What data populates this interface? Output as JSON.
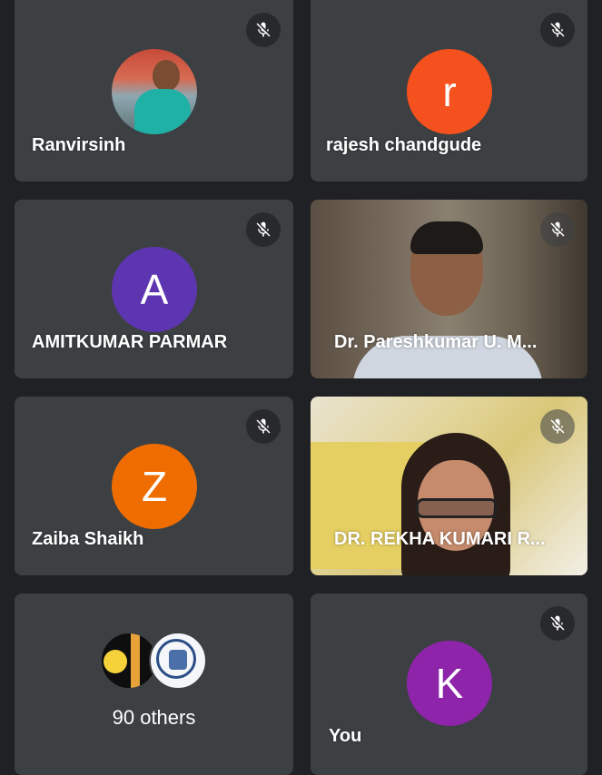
{
  "participants": [
    {
      "name": "Ranvirsinh",
      "muted": true,
      "avatar": "photo"
    },
    {
      "name": "rajesh chandgude",
      "muted": true,
      "initial": "r",
      "color": "#f4511e"
    },
    {
      "name": "AMITKUMAR PARMAR",
      "muted": true,
      "initial": "A",
      "color": "#5e35b1"
    },
    {
      "name": "Dr. Pareshkumar U. M...",
      "muted": true,
      "avatar": "video"
    },
    {
      "name": "Zaiba Shaikh",
      "muted": true,
      "initial": "Z",
      "color": "#ef6c00"
    },
    {
      "name": "DR. REKHA KUMARI R...",
      "muted": true,
      "avatar": "video"
    }
  ],
  "others": {
    "label": "90 others"
  },
  "self": {
    "name": "You",
    "initial": "K",
    "color": "#8e24aa",
    "muted": true
  },
  "icons": {
    "mute": "mic-off-icon"
  }
}
